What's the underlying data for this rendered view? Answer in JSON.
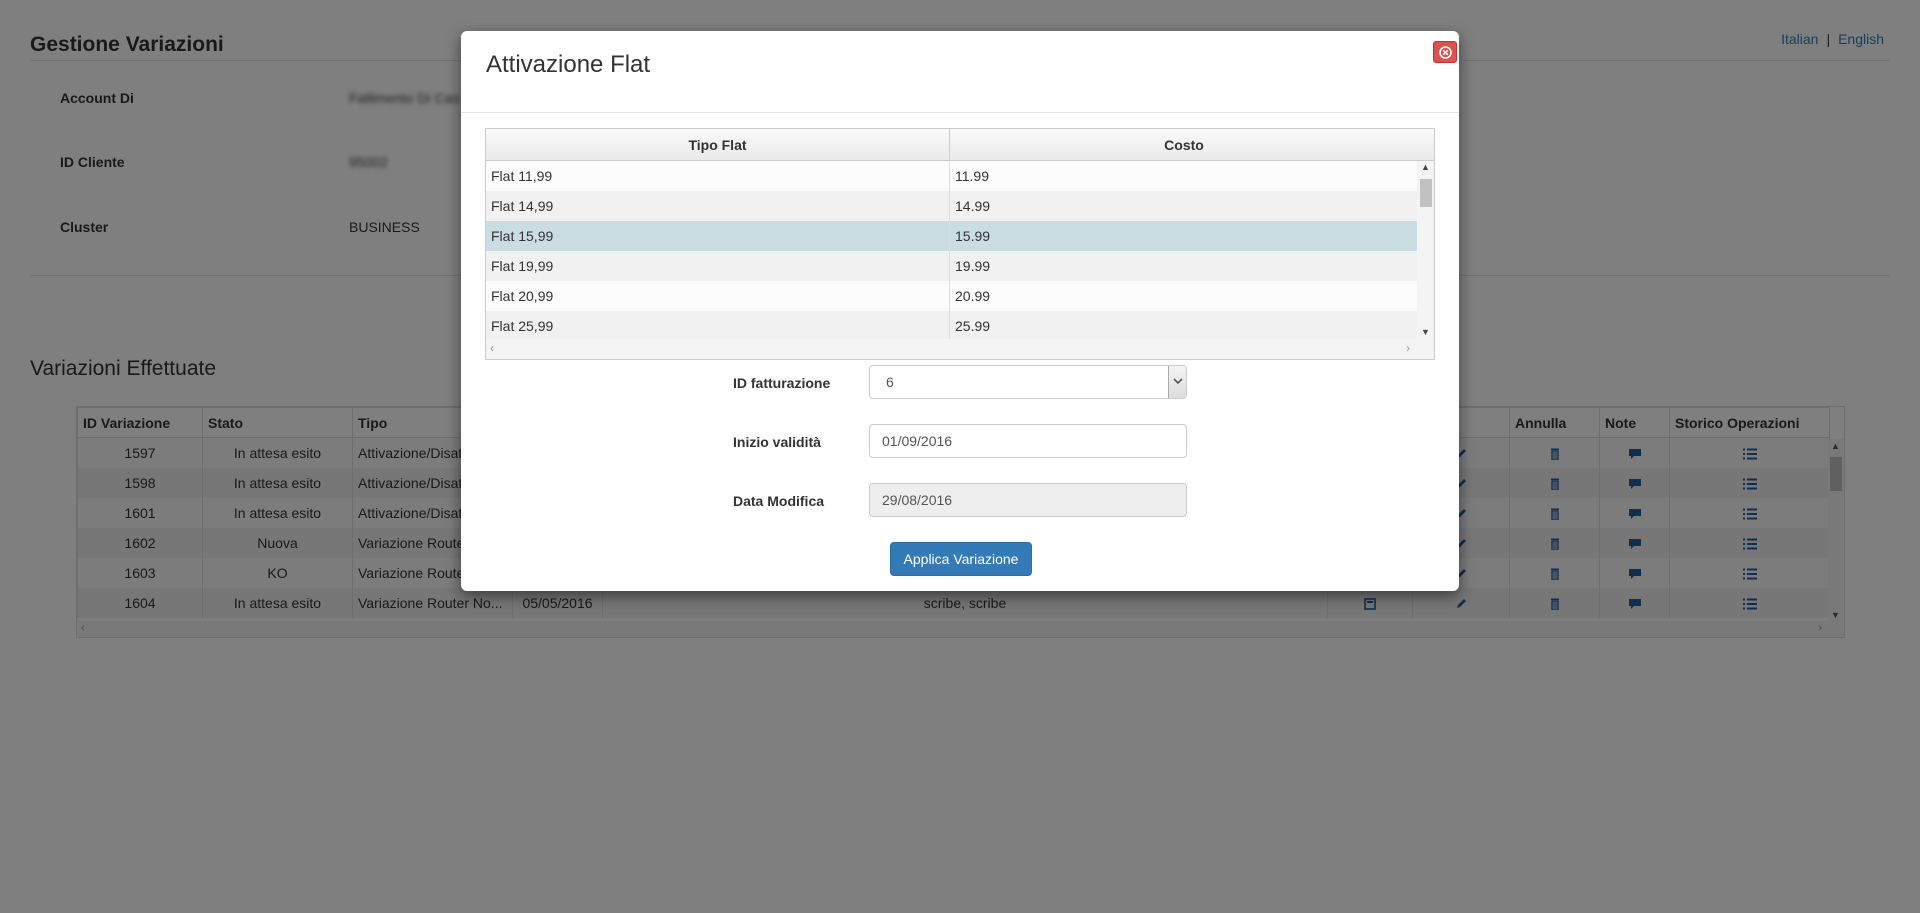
{
  "page": {
    "title": "Gestione Variazioni",
    "languages": [
      "Italian",
      "English"
    ],
    "lang_separator": "|",
    "info": [
      {
        "label": "Account Di",
        "value": "Fallimento Di Cas"
      },
      {
        "label": "ID Cliente",
        "value": "95002"
      },
      {
        "label": "Cluster",
        "value": "BUSINESS"
      }
    ],
    "section_title": "Variazioni Effettuate",
    "table": {
      "headers": [
        "ID Variazione",
        "Stato",
        "Tipo",
        "",
        "",
        "",
        "ica",
        "Annulla",
        "Note",
        "Storico Operazioni"
      ],
      "rows": [
        {
          "id": "1597",
          "stato": "In attesa esito",
          "tipo": "Attivazione/Disat",
          "date": "",
          "desc": ""
        },
        {
          "id": "1598",
          "stato": "In attesa esito",
          "tipo": "Attivazione/Disat",
          "date": "",
          "desc": ""
        },
        {
          "id": "1601",
          "stato": "In attesa esito",
          "tipo": "Attivazione/Disat",
          "date": "",
          "desc": ""
        },
        {
          "id": "1602",
          "stato": "Nuova",
          "tipo": "Variazione Router",
          "date": "",
          "desc": ""
        },
        {
          "id": "1603",
          "stato": "KO",
          "tipo": "Variazione Router",
          "date": "",
          "desc": ""
        },
        {
          "id": "1604",
          "stato": "In attesa esito",
          "tipo": "Variazione Router No...",
          "date": "05/05/2016",
          "desc": "scribe, scribe"
        }
      ]
    }
  },
  "modal": {
    "title": "Attivazione Flat",
    "close_icon": "close-circle-icon",
    "grid": {
      "headers": [
        "Tipo Flat",
        "Costo"
      ],
      "rows": [
        {
          "tipo": "Flat 11,99",
          "costo": "11.99"
        },
        {
          "tipo": "Flat 14,99",
          "costo": "14.99"
        },
        {
          "tipo": "Flat 15,99",
          "costo": "15.99"
        },
        {
          "tipo": "Flat 19,99",
          "costo": "19.99"
        },
        {
          "tipo": "Flat 20,99",
          "costo": "20.99"
        },
        {
          "tipo": "Flat 25,99",
          "costo": "25.99"
        }
      ],
      "selected_row": 2
    },
    "form": {
      "id_fatturazione": {
        "label": "ID fatturazione",
        "value": "6"
      },
      "inizio_validita": {
        "label": "Inizio validità",
        "value": "01/09/2016"
      },
      "data_modifica": {
        "label": "Data Modifica",
        "value": "29/08/2016"
      }
    },
    "apply_label": "Applica Variazione"
  },
  "colors": {
    "primary": "#337ab7",
    "danger": "#d9534f",
    "selected_row": "#c9dde2",
    "icon": "#1f5f9e"
  }
}
